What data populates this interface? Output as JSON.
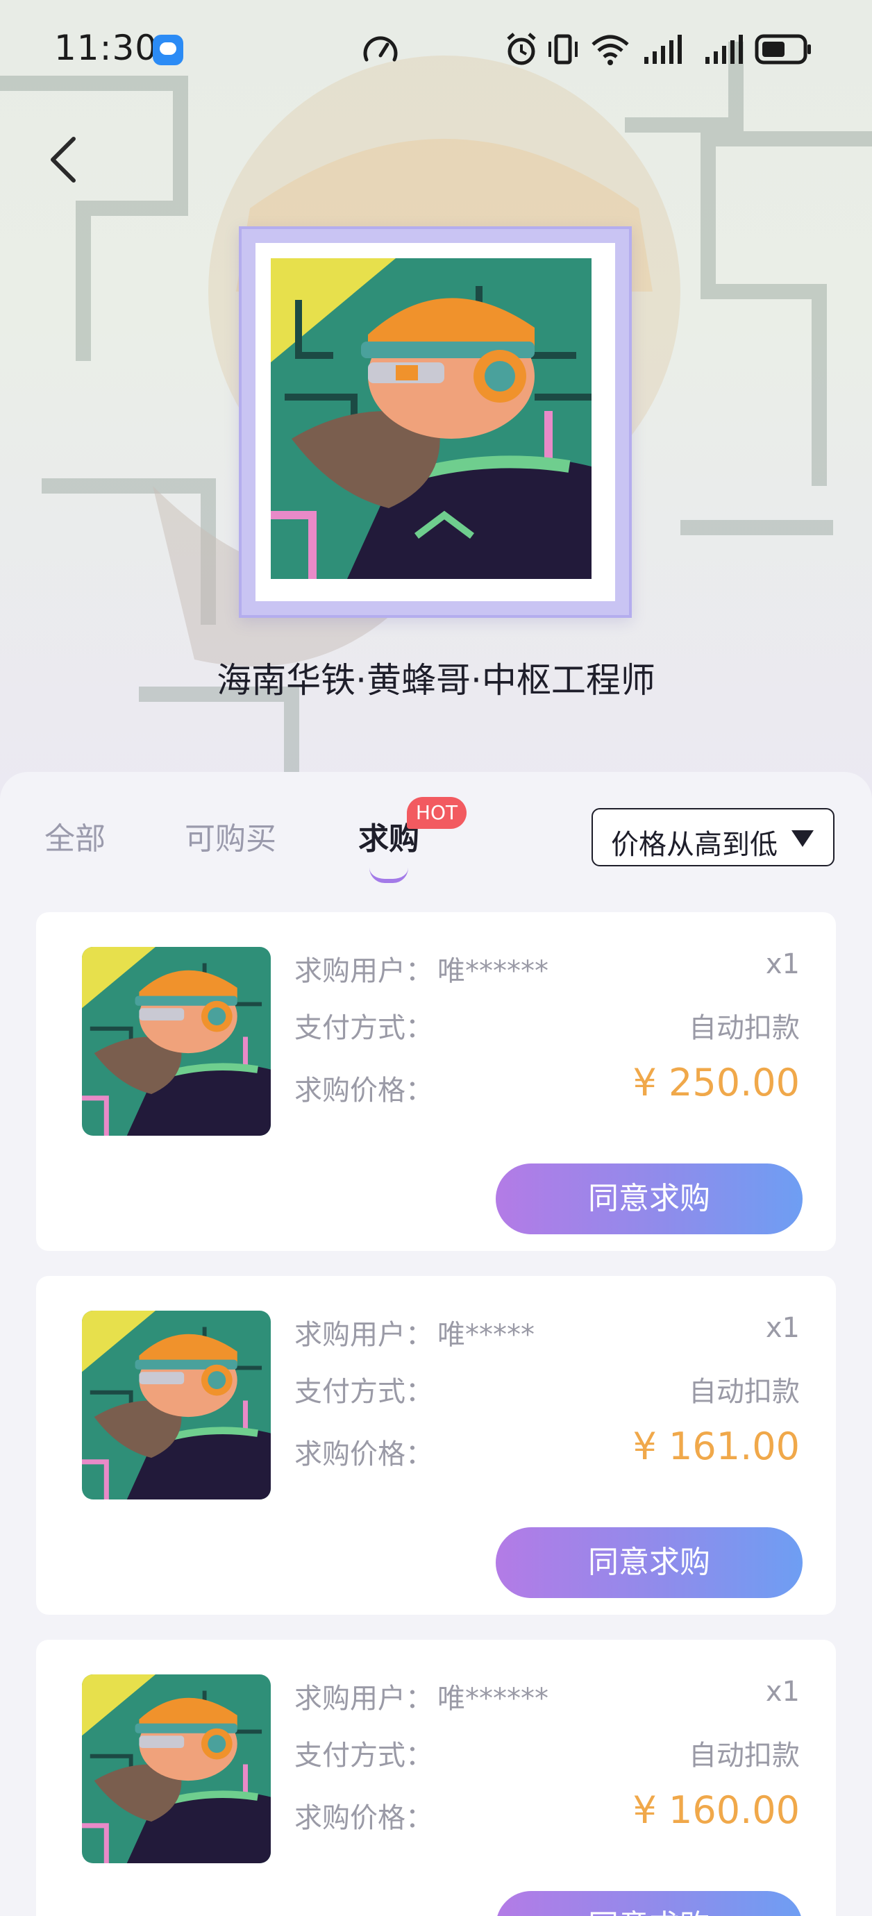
{
  "status_bar": {
    "time": "11:30"
  },
  "nft": {
    "title": "海南华铁·黄蜂哥·中枢工程师"
  },
  "tabs": {
    "all": "全部",
    "buyable": "可购买",
    "wanted": "求购",
    "hot_badge": "HOT"
  },
  "sort": {
    "label": "价格从高到低"
  },
  "labels": {
    "user": "求购用户：",
    "payment": "支付方式：",
    "price": "求购价格："
  },
  "orders": [
    {
      "user": "唯******",
      "qty": "x1",
      "payment": "自动扣款",
      "price": "¥ 250.00",
      "action": "同意求购"
    },
    {
      "user": "唯*****",
      "qty": "x1",
      "payment": "自动扣款",
      "price": "¥ 161.00",
      "action": "同意求购"
    },
    {
      "user": "唯******",
      "qty": "x1",
      "payment": "自动扣款",
      "price": "¥ 160.00",
      "action": "同意求购"
    }
  ],
  "colors": {
    "accent_price": "#f0a84a",
    "hot_badge": "#f25a60",
    "button_gradient_start": "#b37be6",
    "button_gradient_end": "#6e9ef3",
    "tab_indicator": "#a37ae8"
  }
}
